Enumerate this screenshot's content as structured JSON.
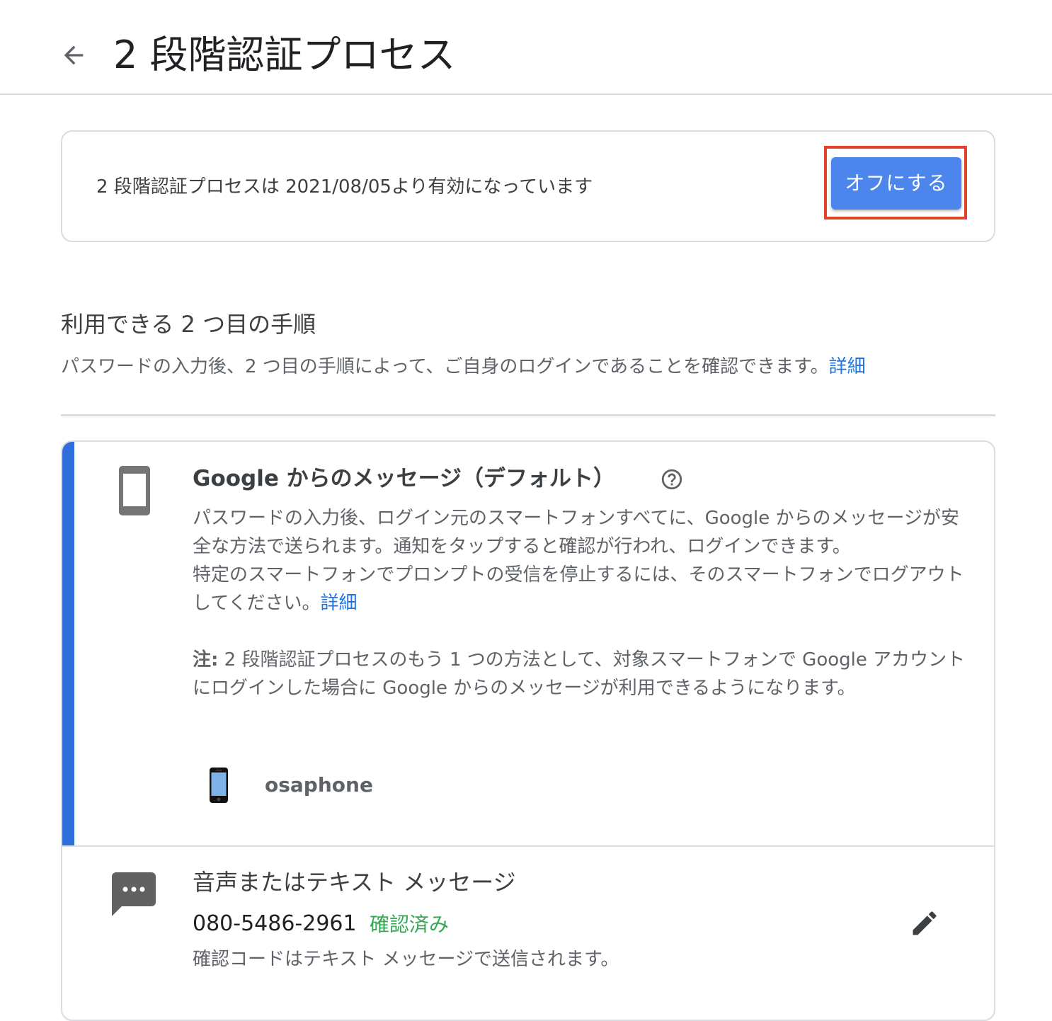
{
  "header": {
    "back_icon": "arrow-back-icon",
    "title": "2 段階認証プロセス"
  },
  "status": {
    "text": "2 段階認証プロセスは 2021/08/05より有効になっています",
    "turn_off_label": "オフにする",
    "button_color": "#4c86ec",
    "highlight_color": "#e2422a"
  },
  "second_steps": {
    "heading": "利用できる 2 つ目の手順",
    "description": "パスワードの入力後、2 つ目の手順によって、ご自身のログインであることを確認できます。",
    "learn_more": "詳細"
  },
  "google_prompt": {
    "icon": "smartphone-icon",
    "title": "Google からのメッセージ（デフォルト）",
    "help_icon": "help-circle-icon",
    "body_1": "パスワードの入力後、ログイン元のスマートフォンすべてに、Google からのメッセージが安全な方法で送られます。通知をタップすると確認が行われ、ログインできます。",
    "body_2": "特定のスマートフォンでプロンプトの受信を停止するには、そのスマートフォンでログアウトしてください。",
    "learn_more": "詳細",
    "note_label": "注:",
    "note_text": " 2 段階認証プロセスのもう 1 つの方法として、対象スマートフォンで Google アカウントにログインした場合に Google からのメッセージが利用できるようになります。",
    "device_icon": "iphone-icon",
    "device_name": "osaphone",
    "accent_color": "#2e6fdc"
  },
  "sms": {
    "icon": "sms-icon",
    "title": "音声またはテキスト メッセージ",
    "phone_number": "080-5486-2961",
    "verified": "確認済み",
    "verified_color": "#34a853",
    "description": "確認コードはテキスト メッセージで送信されます。",
    "edit_icon": "pencil-icon"
  }
}
